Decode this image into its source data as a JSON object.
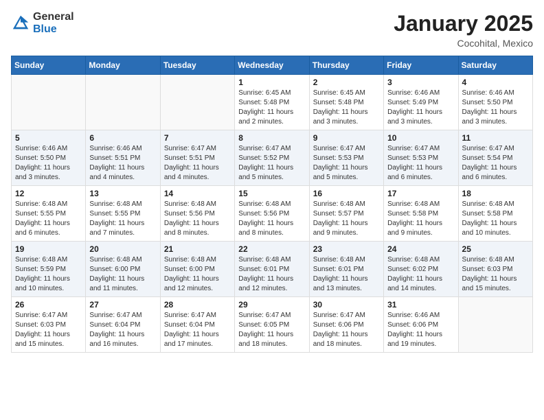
{
  "header": {
    "logo_general": "General",
    "logo_blue": "Blue",
    "month_title": "January 2025",
    "location": "Cocohital, Mexico"
  },
  "weekdays": [
    "Sunday",
    "Monday",
    "Tuesday",
    "Wednesday",
    "Thursday",
    "Friday",
    "Saturday"
  ],
  "weeks": [
    [
      {
        "day": "",
        "info": ""
      },
      {
        "day": "",
        "info": ""
      },
      {
        "day": "",
        "info": ""
      },
      {
        "day": "1",
        "info": "Sunrise: 6:45 AM\nSunset: 5:48 PM\nDaylight: 11 hours and 2 minutes."
      },
      {
        "day": "2",
        "info": "Sunrise: 6:45 AM\nSunset: 5:48 PM\nDaylight: 11 hours and 3 minutes."
      },
      {
        "day": "3",
        "info": "Sunrise: 6:46 AM\nSunset: 5:49 PM\nDaylight: 11 hours and 3 minutes."
      },
      {
        "day": "4",
        "info": "Sunrise: 6:46 AM\nSunset: 5:50 PM\nDaylight: 11 hours and 3 minutes."
      }
    ],
    [
      {
        "day": "5",
        "info": "Sunrise: 6:46 AM\nSunset: 5:50 PM\nDaylight: 11 hours and 3 minutes."
      },
      {
        "day": "6",
        "info": "Sunrise: 6:46 AM\nSunset: 5:51 PM\nDaylight: 11 hours and 4 minutes."
      },
      {
        "day": "7",
        "info": "Sunrise: 6:47 AM\nSunset: 5:51 PM\nDaylight: 11 hours and 4 minutes."
      },
      {
        "day": "8",
        "info": "Sunrise: 6:47 AM\nSunset: 5:52 PM\nDaylight: 11 hours and 5 minutes."
      },
      {
        "day": "9",
        "info": "Sunrise: 6:47 AM\nSunset: 5:53 PM\nDaylight: 11 hours and 5 minutes."
      },
      {
        "day": "10",
        "info": "Sunrise: 6:47 AM\nSunset: 5:53 PM\nDaylight: 11 hours and 6 minutes."
      },
      {
        "day": "11",
        "info": "Sunrise: 6:47 AM\nSunset: 5:54 PM\nDaylight: 11 hours and 6 minutes."
      }
    ],
    [
      {
        "day": "12",
        "info": "Sunrise: 6:48 AM\nSunset: 5:55 PM\nDaylight: 11 hours and 6 minutes."
      },
      {
        "day": "13",
        "info": "Sunrise: 6:48 AM\nSunset: 5:55 PM\nDaylight: 11 hours and 7 minutes."
      },
      {
        "day": "14",
        "info": "Sunrise: 6:48 AM\nSunset: 5:56 PM\nDaylight: 11 hours and 8 minutes."
      },
      {
        "day": "15",
        "info": "Sunrise: 6:48 AM\nSunset: 5:56 PM\nDaylight: 11 hours and 8 minutes."
      },
      {
        "day": "16",
        "info": "Sunrise: 6:48 AM\nSunset: 5:57 PM\nDaylight: 11 hours and 9 minutes."
      },
      {
        "day": "17",
        "info": "Sunrise: 6:48 AM\nSunset: 5:58 PM\nDaylight: 11 hours and 9 minutes."
      },
      {
        "day": "18",
        "info": "Sunrise: 6:48 AM\nSunset: 5:58 PM\nDaylight: 11 hours and 10 minutes."
      }
    ],
    [
      {
        "day": "19",
        "info": "Sunrise: 6:48 AM\nSunset: 5:59 PM\nDaylight: 11 hours and 10 minutes."
      },
      {
        "day": "20",
        "info": "Sunrise: 6:48 AM\nSunset: 6:00 PM\nDaylight: 11 hours and 11 minutes."
      },
      {
        "day": "21",
        "info": "Sunrise: 6:48 AM\nSunset: 6:00 PM\nDaylight: 11 hours and 12 minutes."
      },
      {
        "day": "22",
        "info": "Sunrise: 6:48 AM\nSunset: 6:01 PM\nDaylight: 11 hours and 12 minutes."
      },
      {
        "day": "23",
        "info": "Sunrise: 6:48 AM\nSunset: 6:01 PM\nDaylight: 11 hours and 13 minutes."
      },
      {
        "day": "24",
        "info": "Sunrise: 6:48 AM\nSunset: 6:02 PM\nDaylight: 11 hours and 14 minutes."
      },
      {
        "day": "25",
        "info": "Sunrise: 6:48 AM\nSunset: 6:03 PM\nDaylight: 11 hours and 15 minutes."
      }
    ],
    [
      {
        "day": "26",
        "info": "Sunrise: 6:47 AM\nSunset: 6:03 PM\nDaylight: 11 hours and 15 minutes."
      },
      {
        "day": "27",
        "info": "Sunrise: 6:47 AM\nSunset: 6:04 PM\nDaylight: 11 hours and 16 minutes."
      },
      {
        "day": "28",
        "info": "Sunrise: 6:47 AM\nSunset: 6:04 PM\nDaylight: 11 hours and 17 minutes."
      },
      {
        "day": "29",
        "info": "Sunrise: 6:47 AM\nSunset: 6:05 PM\nDaylight: 11 hours and 18 minutes."
      },
      {
        "day": "30",
        "info": "Sunrise: 6:47 AM\nSunset: 6:06 PM\nDaylight: 11 hours and 18 minutes."
      },
      {
        "day": "31",
        "info": "Sunrise: 6:46 AM\nSunset: 6:06 PM\nDaylight: 11 hours and 19 minutes."
      },
      {
        "day": "",
        "info": ""
      }
    ]
  ]
}
